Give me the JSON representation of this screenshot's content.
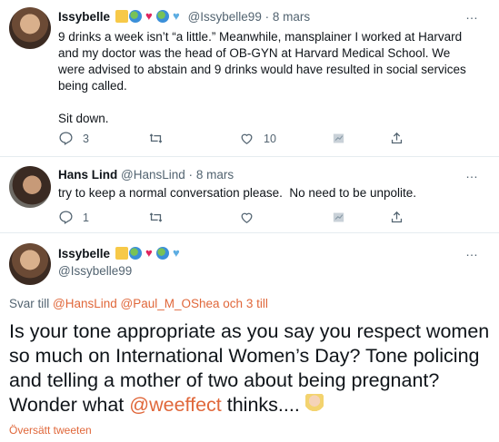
{
  "tweet1": {
    "name": "Issybelle",
    "handle": "@Issybelle99",
    "dot": "·",
    "date": "8 mars",
    "body": "9 drinks a week isn’t “a little.” Meanwhile, mansplainer I worked at Harvard\nand my doctor was the head of OB-GYN at Harvard Medical School. We\nwere advised to abstain and 9 drinks would have resulted in social services\nbeing called.\n\nSit down.",
    "reply_count": "3",
    "like_count": "10"
  },
  "tweet2": {
    "name": "Hans Lind",
    "handle": "@HansLind",
    "dot": "·",
    "date": "8 mars",
    "body": "try to keep a normal conversation please.  No need to be unpolite.",
    "reply_count": "1"
  },
  "tweet3": {
    "name": "Issybelle",
    "handle": "@Issybelle99",
    "reply_prefix": "Svar till ",
    "reply_user1": "@HansLind",
    "reply_user2": "@Paul_M_OShea",
    "reply_suffix": "  och 3 till",
    "body_before": "Is your tone appropriate as you say you respect women so much on International Women’s Day? Tone policing and telling a mother of two about being pregnant? Wonder what ",
    "body_mention": "@weeffect",
    "body_after": " thinks.... ",
    "translate": "Översätt tweeten"
  },
  "more_icon": "…",
  "emojis": [
    "family-icon",
    "earth-icon",
    "heart-icon",
    "earth-icon",
    "blue-heart-icon"
  ],
  "colors": {
    "link": "#e0673a",
    "muted": "#536471",
    "text": "#0f1419"
  }
}
